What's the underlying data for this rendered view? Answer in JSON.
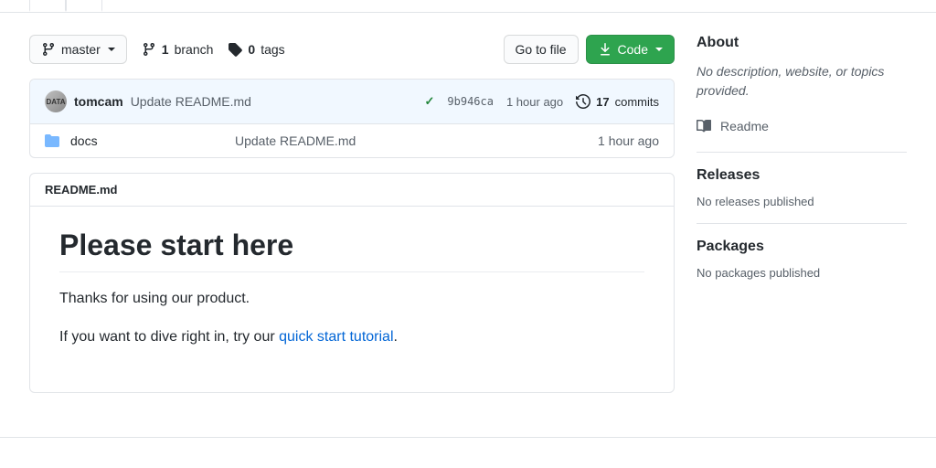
{
  "branch": {
    "name": "master"
  },
  "counts": {
    "branches": "1",
    "branches_label": "branch",
    "tags": "0",
    "tags_label": "tags"
  },
  "buttons": {
    "gotofile": "Go to file",
    "code": "Code"
  },
  "commit": {
    "author": "tomcam",
    "message": "Update README.md",
    "sha": "9b946ca",
    "time": "1 hour ago",
    "count": "17",
    "count_label": "commits"
  },
  "files": [
    {
      "name": "docs",
      "message": "Update README.md",
      "time": "1 hour ago"
    }
  ],
  "readme": {
    "filename": "README.md",
    "heading": "Please start here",
    "p1": "Thanks for using our product.",
    "p2_prefix": "If you want to dive right in, try our ",
    "p2_link": "quick start tutorial",
    "p2_suffix": "."
  },
  "sidebar": {
    "about_title": "About",
    "about_desc": "No description, website, or topics provided.",
    "readme_link": "Readme",
    "releases_title": "Releases",
    "releases_text": "No releases published",
    "packages_title": "Packages",
    "packages_text": "No packages published"
  }
}
